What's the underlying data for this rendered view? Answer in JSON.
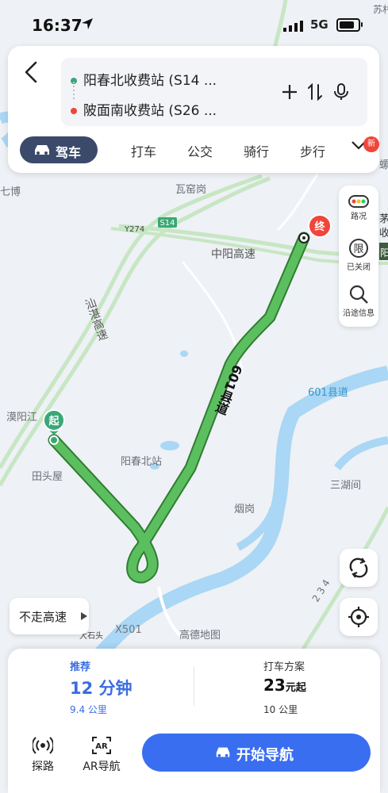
{
  "status_bar": {
    "time": "16:37",
    "network": "5G",
    "battery_level": 0.8
  },
  "route": {
    "origin": "阳春北收费站 (S14 ...",
    "destination": "陂面南收费站 (S26 ..."
  },
  "modes": [
    "驾车",
    "打车",
    "公交",
    "骑行",
    "步行"
  ],
  "new_badge": "新",
  "map": {
    "labels": [
      "苏村",
      "七博",
      "瓦窑岗",
      "Y274",
      "S14",
      "中阳高速",
      "汕湛高速",
      "601县道",
      "漠阳江",
      "阳春北站",
      "田头屋",
      "烟岗",
      "三湖间",
      "大石头",
      "X501",
      "高德地图",
      "茅坡元",
      "收",
      "阳",
      "4",
      "螺",
      "2 3 4"
    ],
    "start_marker": "起",
    "end_marker": "终"
  },
  "tools": {
    "traffic": "路况",
    "closed": "已关闭",
    "closed_icon_text": "限",
    "along_route": "沿途信息"
  },
  "no_highway": "不走高速",
  "summary": {
    "recommend_label": "推荐",
    "duration": "12 分钟",
    "distance": "9.4 公里",
    "taxi_label": "打车方案",
    "taxi_price": "23",
    "taxi_price_suffix": "元起",
    "taxi_distance": "10 公里"
  },
  "bottom_actions": {
    "explore": "探路",
    "ar_nav": "AR导航",
    "start_nav": "开始导航"
  },
  "colors": {
    "accent": "#3a6ef0",
    "route": "#4caf50",
    "start": "#39a878",
    "end": "#f0453a",
    "mode_active": "#3b4a6b"
  }
}
